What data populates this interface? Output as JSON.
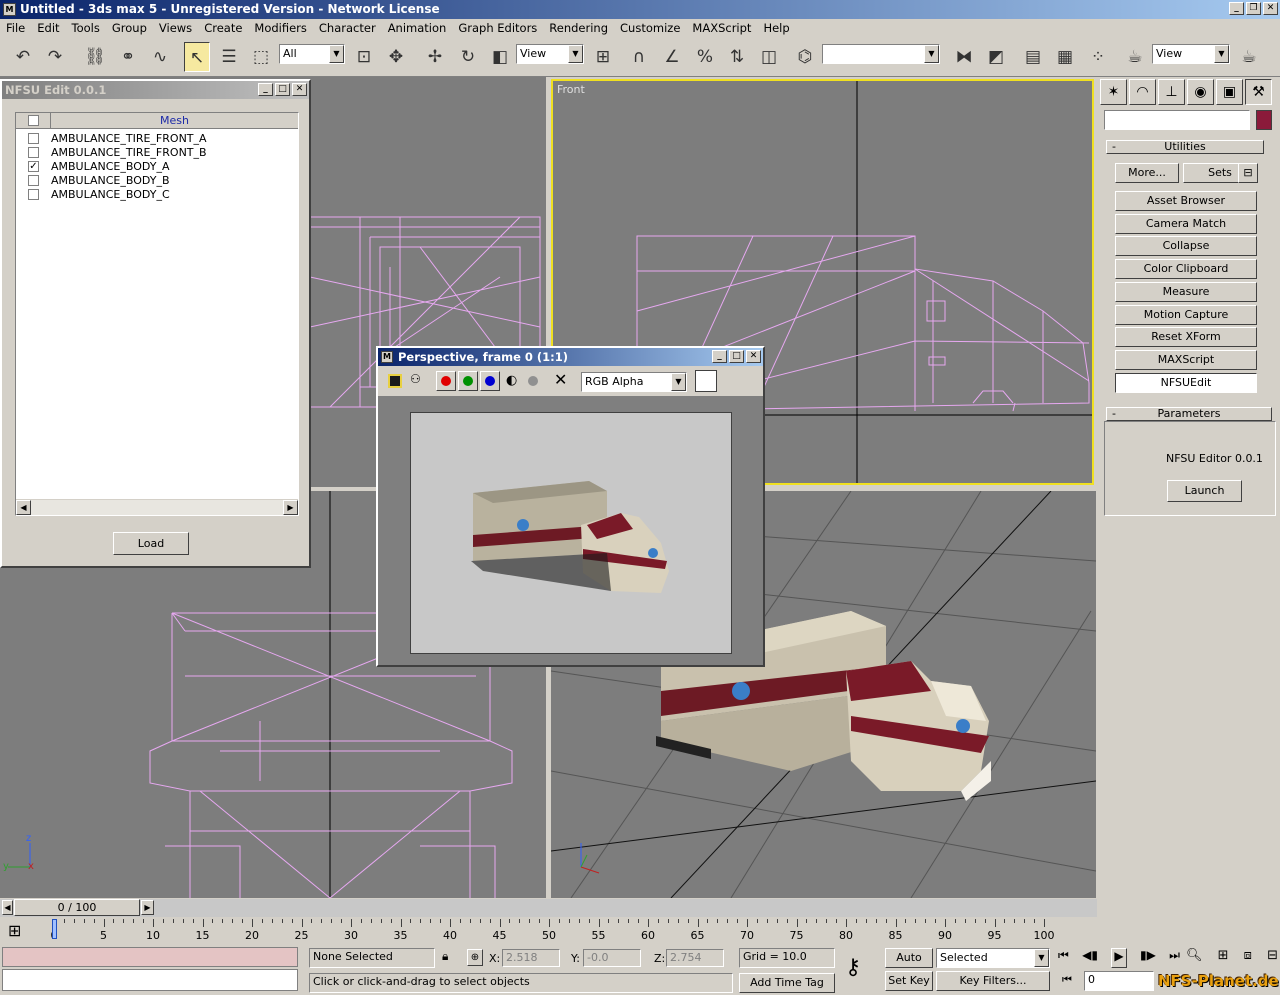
{
  "window": {
    "title": "Untitled - 3ds max 5 - Unregistered Version - Network License",
    "icon": "max-icon"
  },
  "menu": [
    "File",
    "Edit",
    "Tools",
    "Group",
    "Views",
    "Create",
    "Modifiers",
    "Character",
    "Animation",
    "Graph Editors",
    "Rendering",
    "Customize",
    "MAXScript",
    "Help"
  ],
  "toolbar": {
    "selection_filter": "All",
    "ref_coord": "View",
    "named_selection": "",
    "render_view": "View"
  },
  "viewports": {
    "front_label": "Front",
    "axis": {
      "z": "z",
      "y": "y",
      "x": "x"
    }
  },
  "nfsu_panel": {
    "title": "NFSU Edit 0.0.1",
    "column_header": "Mesh",
    "items": [
      {
        "name": "AMBULANCE_TIRE_FRONT_A",
        "checked": false
      },
      {
        "name": "AMBULANCE_TIRE_FRONT_B",
        "checked": false
      },
      {
        "name": "AMBULANCE_BODY_A",
        "checked": true
      },
      {
        "name": "AMBULANCE_BODY_B",
        "checked": false
      },
      {
        "name": "AMBULANCE_BODY_C",
        "checked": false
      }
    ],
    "load_label": "Load"
  },
  "render_window": {
    "title": "Perspective, frame 0 (1:1)",
    "channel": "RGB Alpha"
  },
  "command_panel": {
    "utilities_title": "Utilities",
    "more_label": "More...",
    "sets_label": "Sets",
    "utilities": [
      "Asset Browser",
      "Camera Match",
      "Collapse",
      "Color Clipboard",
      "Measure",
      "Motion Capture",
      "Reset XForm",
      "MAXScript",
      "NFSUEdit"
    ],
    "active_utility": "NFSUEdit",
    "parameters_title": "Parameters",
    "editor_label": "NFSU Editor 0.0.1",
    "launch_label": "Launch",
    "swatch_color": "#8b1a3a"
  },
  "timeline": {
    "frame_display": "0 / 100",
    "ticks": [
      "0",
      "5",
      "10",
      "15",
      "20",
      "25",
      "30",
      "35",
      "40",
      "45",
      "50",
      "55",
      "60",
      "65",
      "70",
      "75",
      "80",
      "85",
      "90",
      "95",
      "100"
    ]
  },
  "status": {
    "selection": "None Selected",
    "x_label": "X:",
    "x_value": "2.518",
    "y_label": "Y:",
    "y_value": "-0.0",
    "z_label": "Z:",
    "z_value": "2.754",
    "grid": "Grid = 10.0",
    "prompt": "Click or click-and-drag to select objects",
    "add_time_tag": "Add Time Tag",
    "auto_key": "Auto Key",
    "set_key": "Set Key",
    "key_mode": "Selected",
    "key_filters": "Key Filters...",
    "current_frame": "0",
    "watermark": "NFS-Planet.de"
  }
}
